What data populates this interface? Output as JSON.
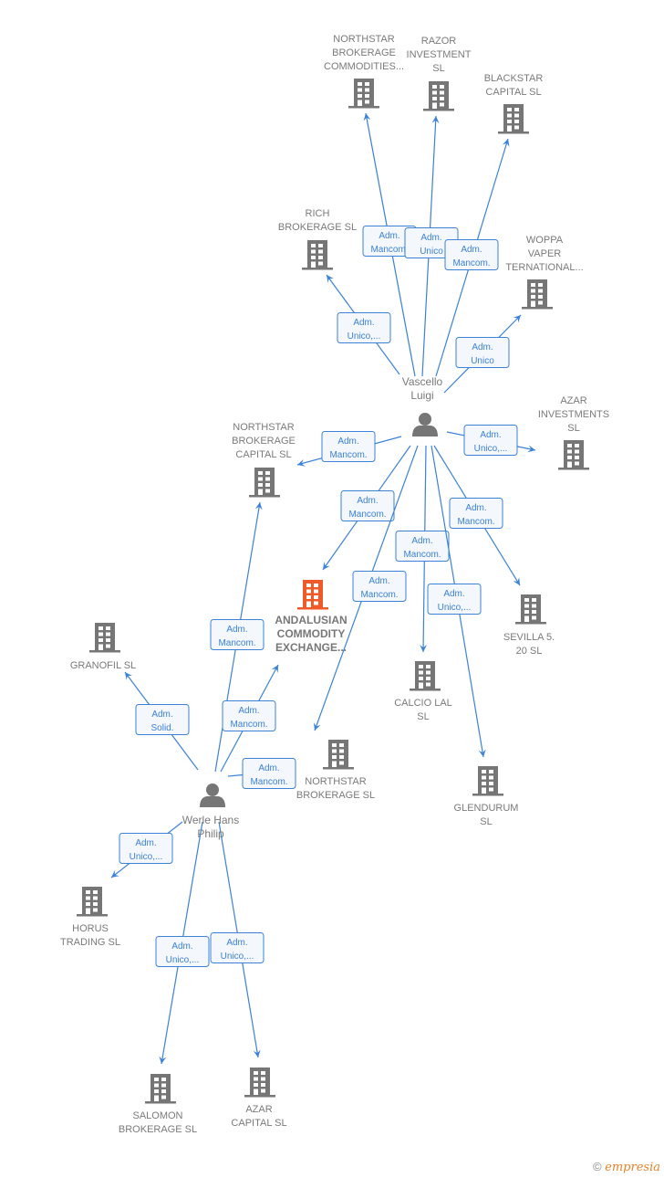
{
  "colors": {
    "edge": "#3b82d8",
    "node": "#767676",
    "focus": "#f05a28",
    "box_border": "#3b82d8",
    "box_bg": "#f4f7fc"
  },
  "nodes": [
    {
      "id": "northstar_commodities",
      "type": "company",
      "lines": [
        "NORTHSTAR",
        "BROKERAGE",
        "COMMODITIES..."
      ]
    },
    {
      "id": "razor",
      "type": "company",
      "lines": [
        "RAZOR",
        "INVESTMENT",
        "SL"
      ]
    },
    {
      "id": "blackstar",
      "type": "company",
      "lines": [
        "BLACKSTAR",
        "CAPITAL  SL"
      ]
    },
    {
      "id": "rich",
      "type": "company",
      "lines": [
        "RICH",
        "BROKERAGE SL"
      ]
    },
    {
      "id": "woppa",
      "type": "company",
      "lines": [
        "WOPPA",
        "VAPER",
        "TERNATIONAL..."
      ]
    },
    {
      "id": "vascello",
      "type": "person",
      "lines": [
        "Vascello",
        "Luigi"
      ]
    },
    {
      "id": "azar_inv",
      "type": "company",
      "lines": [
        "AZAR",
        "INVESTMENTS",
        "SL"
      ]
    },
    {
      "id": "northstar_capital",
      "type": "company",
      "lines": [
        "NORTHSTAR",
        "BROKERAGE",
        "CAPITAL  SL"
      ]
    },
    {
      "id": "andalusian",
      "type": "focus",
      "lines": [
        "ANDALUSIAN",
        "COMMODITY",
        "EXCHANGE..."
      ]
    },
    {
      "id": "sevilla",
      "type": "company",
      "lines": [
        "SEVILLA 5.",
        "20  SL"
      ]
    },
    {
      "id": "calcio",
      "type": "company",
      "lines": [
        "CALCIO LAL",
        "SL"
      ]
    },
    {
      "id": "granofil",
      "type": "company",
      "lines": [
        "GRANOFIL SL"
      ]
    },
    {
      "id": "northstar_brokerage",
      "type": "company",
      "lines": [
        "NORTHSTAR",
        "BROKERAGE SL"
      ]
    },
    {
      "id": "glendurum",
      "type": "company",
      "lines": [
        "GLENDURUM",
        "SL"
      ]
    },
    {
      "id": "werle",
      "type": "person",
      "lines": [
        "Werle Hans",
        "Philip"
      ]
    },
    {
      "id": "horus",
      "type": "company",
      "lines": [
        "HORUS",
        "TRADING  SL"
      ]
    },
    {
      "id": "salomon",
      "type": "company",
      "lines": [
        "SALOMON",
        "BROKERAGE SL"
      ]
    },
    {
      "id": "azar_capital",
      "type": "company",
      "lines": [
        "AZAR",
        "CAPITAL  SL"
      ]
    }
  ],
  "edges": [
    {
      "from": "vascello",
      "to": "northstar_commodities",
      "role": [
        "Adm.",
        "Mancom."
      ]
    },
    {
      "from": "vascello",
      "to": "razor",
      "role": [
        "Adm.",
        "Unico"
      ]
    },
    {
      "from": "vascello",
      "to": "blackstar",
      "role": [
        "Adm.",
        "Mancom."
      ]
    },
    {
      "from": "vascello",
      "to": "rich",
      "role": [
        "Adm.",
        "Unico,..."
      ]
    },
    {
      "from": "vascello",
      "to": "woppa",
      "role": [
        "Adm.",
        "Unico"
      ]
    },
    {
      "from": "vascello",
      "to": "northstar_capital",
      "role": [
        "Adm.",
        "Mancom."
      ]
    },
    {
      "from": "vascello",
      "to": "azar_inv",
      "role": [
        "Adm.",
        "Unico,..."
      ]
    },
    {
      "from": "vascello",
      "to": "andalusian",
      "role": [
        "Adm.",
        "Mancom."
      ]
    },
    {
      "from": "vascello",
      "to": "sevilla",
      "role": [
        "Adm.",
        "Mancom."
      ]
    },
    {
      "from": "vascello",
      "to": "calcio",
      "role": [
        "Adm.",
        "Mancom."
      ]
    },
    {
      "from": "vascello",
      "to": "northstar_brokerage",
      "role": [
        "Adm.",
        "Mancom."
      ]
    },
    {
      "from": "vascello",
      "to": "glendurum",
      "role": [
        "Adm.",
        "Unico,..."
      ]
    },
    {
      "from": "werle",
      "to": "northstar_capital",
      "role": [
        "Adm.",
        "Mancom."
      ]
    },
    {
      "from": "werle",
      "to": "granofil",
      "role": [
        "Adm.",
        "Solid."
      ]
    },
    {
      "from": "werle",
      "to": "andalusian",
      "role": [
        "Adm.",
        "Mancom."
      ]
    },
    {
      "from": "werle",
      "to": "andalusian",
      "role": [
        "Adm.",
        "Mancom."
      ]
    },
    {
      "from": "werle",
      "to": "horus",
      "role": [
        "Adm.",
        "Unico,..."
      ]
    },
    {
      "from": "werle",
      "to": "salomon",
      "role": [
        "Adm.",
        "Unico,..."
      ]
    },
    {
      "from": "werle",
      "to": "azar_capital",
      "role": [
        "Adm.",
        "Unico,..."
      ]
    }
  ],
  "footer": {
    "copyright": "©",
    "brand": "empresia"
  }
}
